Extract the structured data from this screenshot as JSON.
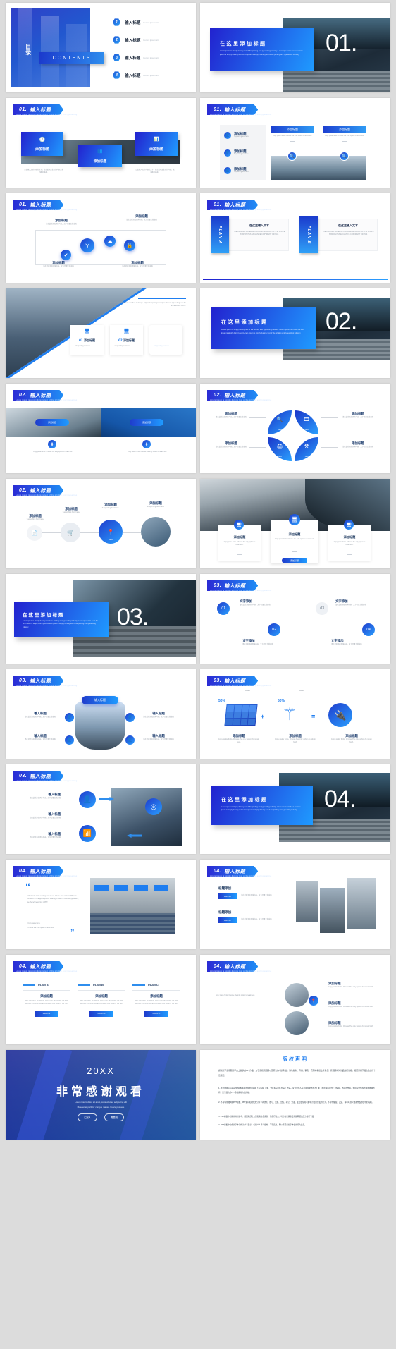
{
  "meta": {
    "doc_type": "PowerPoint template preview grid",
    "slide_count": 24,
    "background_color": "#dcdcdc",
    "accent_blue": "#1f8df5",
    "accent_deep_blue": "#2222cf"
  },
  "common": {
    "title_cn": "输入标题",
    "add_title_cn": "添加标题",
    "here_title_cn": "在这里添加标题",
    "header_sub": "Lorem ipsum is simply dummy text of the printing and typesetting",
    "lorem_short": "Lorem ipsum sit",
    "body_en": "Lorem ipsum is simply dummy text of the printing and typesetting industry. Lorem ipsum has been the omn ipsum is simply dummy text Lorem ipsum is simply dummy text of the printing and typesetting industry.",
    "copy_paste": "Copy paste fonts.  Choose the only option to retain text.",
    "supporting": "Supporting text here.",
    "cn_body": "请在此处添加具体内容，文字尽量言简意赅",
    "cn_body2": "点击输入标题的描述文字，简洁说明该业务的内容，或为概况描述。",
    "text_label": "Text",
    "plan_a": "PLAN A",
    "plan_b": "PLAN B",
    "plan_c": "PLAN C"
  },
  "slides": [
    {
      "index": 1,
      "name": "contents-slide",
      "type": "toc",
      "catalog_cn": "目录",
      "contents_label": "CONTENTS",
      "items": [
        {
          "num": "1",
          "title": "输入标题",
          "sub": "Lorem ipsum sit"
        },
        {
          "num": "2",
          "title": "输入标题",
          "sub": "Lorem ipsum sit"
        },
        {
          "num": "3",
          "title": "输入标题",
          "sub": "Lorem ipsum sit"
        },
        {
          "num": "4",
          "title": "输入标题",
          "sub": "Lorem ipsum sit"
        }
      ]
    },
    {
      "index": 2,
      "name": "section-divider-01",
      "type": "divider",
      "number": "01.",
      "title": "在这里添加标题",
      "body": "Lorem ipsum is simply dummy text of the printing and typesetting industry.  Lorem ipsum has been the omn ipsum is simply dummy text Lorem ipsum is simply dummy text of the printing and typesetting industry."
    },
    {
      "index": 3,
      "name": "content-01-three-cards",
      "type": "content",
      "header_num": "01.",
      "header_title": "输入标题",
      "cards": [
        {
          "icon": "clock-icon",
          "title": "添加标题"
        },
        {
          "icon": "people-icon",
          "title": "添加标题"
        },
        {
          "icon": "chart-icon",
          "title": "添加标题"
        }
      ],
      "captions": [
        "点击输入您对内容的文字，简洁说明该业务的内容，或为概况描述。",
        "点击输入您对内容的文字，简洁说明该业务的内容，或为概况描述。"
      ]
    },
    {
      "index": 4,
      "name": "content-01-list-and-panels",
      "type": "content",
      "header_num": "01.",
      "header_title": "输入标题",
      "list_items": [
        {
          "title": "添加标题",
          "sub": "Supporting text here."
        },
        {
          "title": "添加标题",
          "sub": "Supporting text here."
        },
        {
          "title": "添加标题",
          "sub": "Supporting text here."
        }
      ],
      "panels": [
        {
          "title": "添加标题",
          "body": "Copy paste fonts.  Choose the only option to retain text."
        },
        {
          "title": "添加标题",
          "body": "Copy paste fonts.  Choose the only option to retain text."
        }
      ]
    },
    {
      "index": 5,
      "name": "content-01-four-circles",
      "type": "content",
      "header_num": "01.",
      "header_title": "输入标题",
      "nodes": [
        {
          "icon": "check-icon",
          "title": "添加标题",
          "body": "请在此处添加具体内容，文字尽量言简意赅"
        },
        {
          "icon": "share-icon",
          "title": "添加标题",
          "body": "请在此处添加具体内容，文字尽量言简意赅"
        },
        {
          "icon": "cloud-icon",
          "title": "添加标题",
          "body": "请在此处添加具体内容，文字尽量言简意赅"
        },
        {
          "icon": "lock-icon",
          "title": "添加标题",
          "body": "请在此处添加具体内容，文字尽量言简意赅"
        }
      ]
    },
    {
      "index": 6,
      "name": "content-01-plan-ab",
      "type": "content",
      "header_num": "01.",
      "header_title": "输入标题",
      "plans": [
        {
          "tab": "PLAN A",
          "title": "在这里输入文本",
          "body": "THE ORIGINAL MATERIAL PACKAGE NETWORK OF THE WHOLE STATION HAS EXCLUSIVE COPYRIGHT OR HAS"
        },
        {
          "tab": "PLAN B",
          "title": "在这里输入文本",
          "body": "THE ORIGINAL MATERIAL PACKAGE NETWORK OF THE WHOLE STATION HAS EXCLUSIVE COPYRIGHT OR HAS"
        }
      ]
    },
    {
      "index": 7,
      "name": "content-diagonal-photo-cards",
      "type": "content",
      "note": "There are many PPT more excellent to change. Adjust the spacing to adapt to Chinese typesetting, use the reference line in PPT.",
      "cards": [
        {
          "num": "01",
          "title": "添加标题",
          "bullet": "Supporting text here."
        },
        {
          "num": "02",
          "title": "添加标题",
          "bullet": "Supporting text here."
        },
        {
          "num": "03",
          "title": "添加标题",
          "bullet": "Supporting text here."
        }
      ]
    },
    {
      "index": 8,
      "name": "section-divider-02",
      "type": "divider",
      "number": "02.",
      "title": "在这里添加标题",
      "body": "Lorem ipsum is simply dummy text of the printing and typesetting industry.  Lorem ipsum has been the omn ipsum is simply dummy text Lorem ipsum is simply dummy text of the printing and typesetting industry."
    },
    {
      "index": 9,
      "name": "content-02-two-photo-cards",
      "type": "content",
      "header_num": "02.",
      "header_title": "输入标题",
      "cards": [
        {
          "title": "添加标题",
          "body": "Copy paste fonts.  Choose the only option to retain text."
        },
        {
          "title": "添加标题",
          "body": "Copy paste fonts.  Choose the only option to retain text."
        }
      ]
    },
    {
      "index": 10,
      "name": "content-02-pinwheel",
      "type": "content",
      "header_num": "02.",
      "header_title": "输入标题",
      "segments": [
        {
          "icon": "search-icon",
          "label": "Text"
        },
        {
          "icon": "film-icon",
          "label": "Text"
        },
        {
          "icon": "printer-icon",
          "label": "Text"
        },
        {
          "icon": "tools-icon",
          "label": "Text"
        }
      ],
      "callouts": [
        {
          "title": "添加标题",
          "body": "请在此处添加具体内容，文字尽量言简意赅"
        },
        {
          "title": "添加标题",
          "body": "请在此处添加具体内容，文字尽量言简意赅"
        },
        {
          "title": "添加标题",
          "body": "请在此处添加具体内容，文字尽量言简意赅"
        },
        {
          "title": "添加标题",
          "body": "请在此处添加具体内容，文字尽量言简意赅"
        }
      ]
    },
    {
      "index": 11,
      "name": "content-02-process-circles",
      "type": "content",
      "header_num": "02.",
      "header_title": "输入标题",
      "steps": [
        {
          "icon": "doc-icon",
          "label": "Text",
          "title": "添加标题",
          "sub": "Supporting text here."
        },
        {
          "icon": "cart-icon",
          "label": "Text",
          "title": "添加标题",
          "sub": "Supporting text here."
        },
        {
          "icon": "pin-icon",
          "label": "Text",
          "title": "添加标题",
          "sub": "Supporting text here."
        },
        {
          "icon": "photo-icon",
          "label": "Text",
          "title": "添加标题",
          "sub": "Supporting text here."
        }
      ]
    },
    {
      "index": 12,
      "name": "content-photo-three-cards",
      "type": "content",
      "cards": [
        {
          "icon": "monitor-icon",
          "title": "添加标题",
          "body": "Copy paste fonts.  Choose the only option to retain text."
        },
        {
          "icon": "monitor-icon",
          "title": "添加标题",
          "body": "Copy paste fonts.  Choose the only option to retain text."
        },
        {
          "icon": "monitor-icon",
          "title": "添加标题",
          "body": "Copy paste fonts.  Choose the only option to retain text."
        }
      ],
      "button_label": "添加标题"
    },
    {
      "index": 13,
      "name": "section-divider-03",
      "type": "divider",
      "number": "03.",
      "title": "在这里添加标题",
      "body": "Lorem ipsum is simply dummy text of the printing and typesetting industry.  Lorem ipsum has been the omn ipsum is simply dummy text Lorem ipsum is simply dummy text of the printing and typesetting industry."
    },
    {
      "index": 14,
      "name": "content-03-numbered-circles",
      "type": "content",
      "header_num": "03.",
      "header_title": "输入标题",
      "nodes": [
        {
          "num": "01",
          "title": "文字添加",
          "body": "请在此处添加具体内容，文字尽量言简意赅"
        },
        {
          "num": "02",
          "title": "文字添加",
          "body": "请在此处添加具体内容，文字尽量言简意赅"
        },
        {
          "num": "03",
          "title": "文字添加",
          "body": "请在此处添加具体内容，文字尽量言简意赅"
        },
        {
          "num": "04",
          "title": "文字添加",
          "body": "请在此处添加具体内容，文字尽量言简意赅"
        }
      ]
    },
    {
      "index": 15,
      "name": "content-03-center-cylinder",
      "type": "content",
      "header_num": "03.",
      "header_title": "输入标题",
      "center_label": "输入标题",
      "nodes": [
        {
          "icon": "user-icon",
          "title": "输入标题",
          "body": "请在此处添加具体内容，文字尽量言简意赅"
        },
        {
          "icon": "user-icon",
          "title": "输入标题",
          "body": "请在此处添加具体内容，文字尽量言简意赅"
        },
        {
          "icon": "user-icon",
          "title": "输入标题",
          "body": "请在此处添加具体内容，文字尽量言简意赅"
        },
        {
          "icon": "user-icon",
          "title": "输入标题",
          "body": "请在此处添加具体内容，文字尽量言简意赅"
        }
      ]
    },
    {
      "index": 16,
      "name": "content-03-energy-icons",
      "type": "content",
      "header_num": "03.",
      "header_title": "输入标题",
      "badges": [
        "50%",
        "50%"
      ],
      "text_labels": [
        "Text",
        "Text"
      ],
      "icons": [
        {
          "icon": "solar-panel-icon",
          "title": "添加标题",
          "body": "Copy paste fonts.  Choose the only option to retain text."
        },
        {
          "icon": "wind-turbine-icon",
          "title": "添加标题",
          "body": "Copy paste fonts.  Choose the only option to retain text."
        },
        {
          "icon": "plug-icon",
          "title": "添加标题",
          "body": "Copy paste fonts.  Choose the only option to retain text."
        }
      ]
    },
    {
      "index": 17,
      "name": "content-03-arrow-cycle",
      "type": "content",
      "header_num": "03.",
      "header_title": "输入标题",
      "nodes": [
        {
          "icon": "person-icon",
          "title": "输入标题",
          "body": "请在此处添加具体内容，文字尽量言简意赅"
        },
        {
          "icon": "target-icon",
          "title": "输入标题",
          "body": "请在此处添加具体内容，文字尽量言简意赅"
        },
        {
          "icon": "bar-chart-icon",
          "title": "输入标题",
          "body": "请在此处添加具体内容，文字尽量言简意赅"
        }
      ]
    },
    {
      "index": 18,
      "name": "section-divider-04",
      "type": "divider",
      "number": "04.",
      "title": "在这里添加标题",
      "body": "Lorem ipsum is simply dummy text of the printing and typesetting industry.  Lorem ipsum has been the omn ipsum is simply dummy text Lorem ipsum is simply dummy text of the printing and typesetting industry."
    },
    {
      "index": 19,
      "name": "content-04-quote",
      "type": "content",
      "header_num": "04.",
      "header_title": "输入标题",
      "quote_mark_open": "“",
      "quote_mark_close": "”",
      "quote_body": "unified fonts make reading more fluent. Theme runs makes PPT more consistent in change. Adjust the spacing to adapt to Chinese typesetting, use the reference line in PPT.",
      "bullets": [
        "Copy paste fonts.",
        "Choose the only option to retain text."
      ]
    },
    {
      "index": 20,
      "name": "content-04-photo-mosaic",
      "type": "content",
      "header_num": "04.",
      "header_title": "输入标题",
      "rows": [
        {
          "title": "标题添加",
          "tag": "Part 01",
          "body": "请在此处添加具体内容，文字尽量言简意赅"
        },
        {
          "title": "标题添加",
          "tag": "Part 02",
          "body": "请在此处添加具体内容，文字尽量言简意赅"
        }
      ]
    },
    {
      "index": 21,
      "name": "content-04-plan-abc",
      "type": "content",
      "header_num": "04.",
      "header_title": "输入标题",
      "columns": [
        {
          "tab": "PLAN A",
          "title": "添加标题",
          "body": "THE ORIGINAL MATERIAL PACKAGE NETWORK OF THE WHOLE STATION HAS EXCLUSIVE COPYRIGHT OR HAS",
          "button": "PLAN A"
        },
        {
          "tab": "PLAN B",
          "title": "添加标题",
          "body": "THE ORIGINAL MATERIAL PACKAGE NETWORK OF THE WHOLE STATION HAS EXCLUSIVE COPYRIGHT OR HAS",
          "button": "PLAN B"
        },
        {
          "tab": "PLAN C",
          "title": "添加标题",
          "body": "THE ORIGINAL MATERIAL PACKAGE NETWORK OF THE WHOLE STATION HAS EXCLUSIVE COPYRIGHT OR HAS",
          "button": "PLAN C"
        }
      ]
    },
    {
      "index": 22,
      "name": "content-04-circles-right",
      "type": "content",
      "header_num": "04.",
      "header_title": "输入标题",
      "intro": "Copy paste fonts.  Choose the only option to retain text.",
      "items": [
        {
          "title": "添加标题",
          "body": "Copy paste fonts.  Choose the only option to retain text."
        },
        {
          "title": "添加标题",
          "body": "Copy paste fonts.  Choose the only option to retain text."
        },
        {
          "title": "添加标题",
          "body": "Copy paste fonts.  Choose the only option to retain text."
        }
      ]
    },
    {
      "index": 23,
      "name": "thank-you-slide",
      "type": "closing",
      "year": "20XX",
      "title": "非常感谢观看",
      "sub_line1": "Lorem ipsum dolor sit amet, consectetuer adipiscing elit",
      "sub_line2": "Maecenas porttitor congue massa. Fusce posuere",
      "buttons": [
        "汇报人",
        "需要用"
      ]
    },
    {
      "index": 24,
      "name": "copyright-slide",
      "type": "copyright",
      "title": "版权声明",
      "intro": "感谢您下载熊图商平台上提供的PPT作品，为了您和熊图网以及原创作者的利益，请勿复制、传播、销售，否则将承担法律责任！熊图网将对作品进行维权，按照传播下载次数进行十倍索赔！",
      "clauses": [
        "1. 在熊图网originalPPT模板素材均在熊图商城上有版权（VIP、VIP Royalty-Free）作品，受《中华人民共和国著作权法》和《世界版权公约》的保护，作品的作者，或授权著作权所属熊图网所有，您下载的是PPT模板素材的使用权。",
        "2. 不得将熊图网的PPT模板、PPT素材和制成形分享予再次售、赠与、出属、出借、转让、分发、变形或任何可解释为使用分发的行为，不得传播权、改造、将以本身公或著作权协议中的权利。",
        "3. PPT模板中的图片只供参考、画面和部分大量名素占供素新、请自行取舍、可与自更请重要熊图网相关部分自行下载。",
        "4. PPT模板中的含的字体字体为参考量示、仅供个人学习使用，不得商用、网以不问意的字体使用行为负责。"
      ]
    }
  ]
}
